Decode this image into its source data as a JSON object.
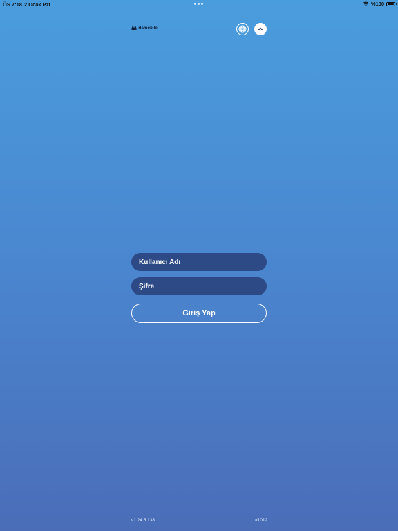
{
  "status_bar": {
    "time": "ÖS 7:18",
    "date": "2 Ocak Pzt",
    "battery_percent": "%100",
    "icons": [
      "wifi-icon",
      "battery-icon"
    ]
  },
  "header": {
    "logo_text": "idamobile",
    "language_icon": "globe-icon",
    "theme_icon": "contrast-icon"
  },
  "login_form": {
    "username_placeholder": "Kullanıcı Adı",
    "password_placeholder": "Şifre",
    "submit_label": "Giriş Yap"
  },
  "footer": {
    "version": "v1.24.5.138",
    "build": "#1012"
  },
  "colors": {
    "background_top": "#4a9ddd",
    "background_bottom": "#4b6db8",
    "field_background": "#2d4a86",
    "text": "#ffffff"
  }
}
